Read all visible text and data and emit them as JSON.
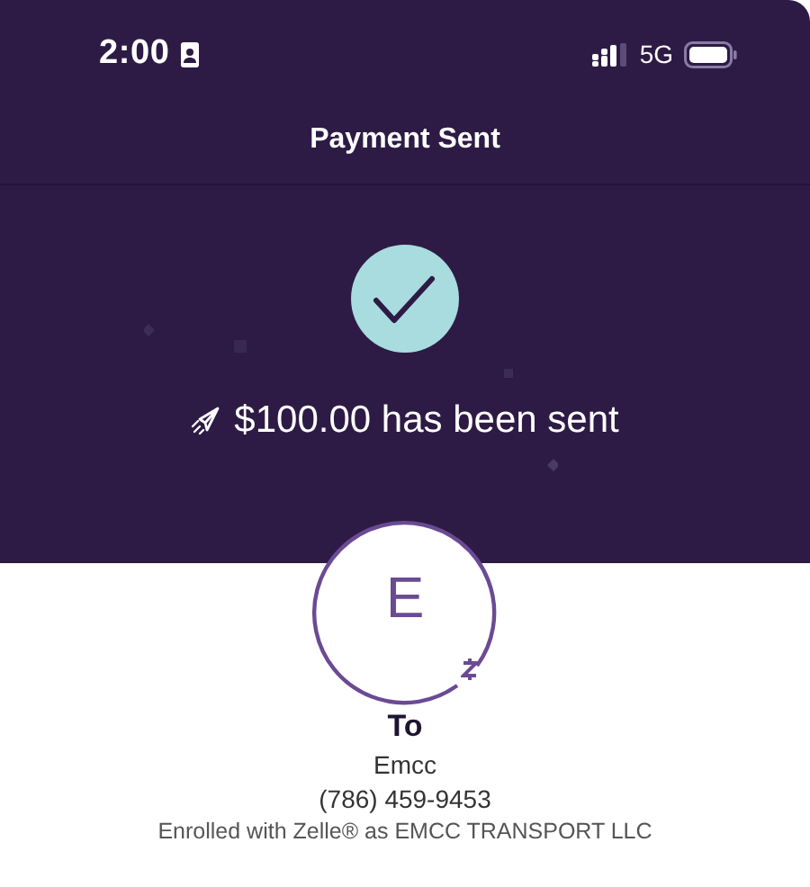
{
  "status_bar": {
    "time": "2:00",
    "network": "5G"
  },
  "header": {
    "title": "Payment Sent"
  },
  "confirmation": {
    "message": "$100.00 has been sent"
  },
  "recipient": {
    "initial": "E",
    "heading": "To",
    "name": "Emcc",
    "phone": "(786) 459-9453",
    "enrollment": "Enrolled with Zelle® as EMCC TRANSPORT LLC"
  }
}
